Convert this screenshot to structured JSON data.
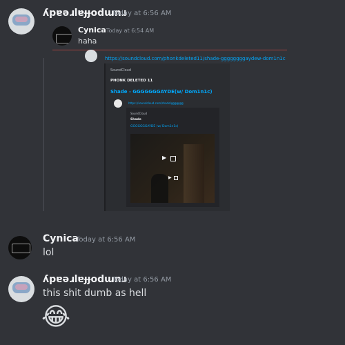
{
  "messages": [
    {
      "author": "ʎpɐǝɹlɐɟɟodɯnɹ",
      "timestamp": "Today at 6:56 AM",
      "reply": {
        "author": "Cynica",
        "timestamp": "Today at 6:54 AM",
        "text": "haha"
      },
      "embed": {
        "url": "https://soundcloud.com/phonkdeleted11/shade-ggggggggaydew-dom1n1c",
        "provider": "SoundCloud",
        "author": "PHONK DELETED 11",
        "title": "Shade - GGGGGGGAYDE(w/ Dom1n1c)",
        "inner": {
          "url": "https://soundcloud.com/shade/ggggggg",
          "provider": "SoundCloud",
          "author": "Shade",
          "title": "GGGGGGGAYDE (w/ Dom1n1c)"
        }
      }
    },
    {
      "author": "Cynica",
      "timestamp": "Today at 6:56 AM",
      "text": "lol"
    },
    {
      "author": "ʎpɐǝɹlɐɟɟodɯnɹ",
      "timestamp": "Today at 6:56 AM",
      "text": "this shit dumb as hell",
      "emoji": "😂"
    }
  ]
}
